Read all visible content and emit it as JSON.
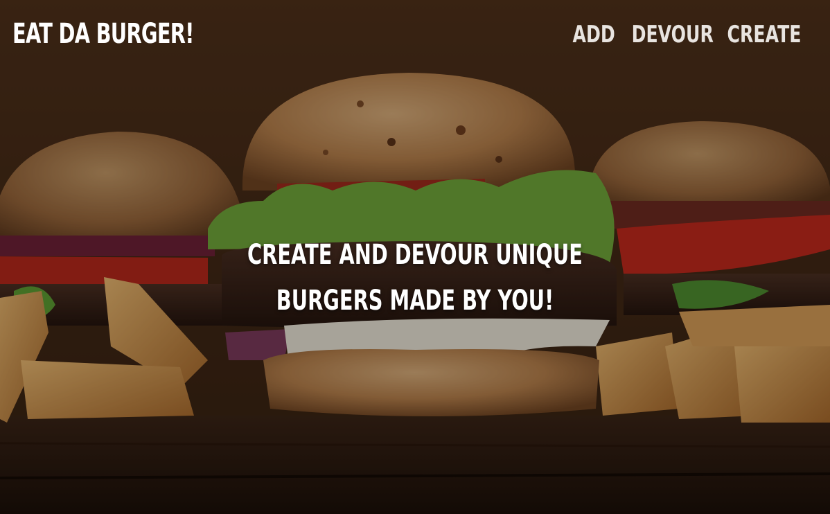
{
  "app": {
    "brand": "EAT DA BURGER!"
  },
  "nav": {
    "items": [
      {
        "label": "ADD"
      },
      {
        "label": "DEVOUR"
      },
      {
        "label": "CREATE"
      }
    ]
  },
  "hero": {
    "headline_line1": "CREATE AND DEVOUR UNIQUE",
    "headline_line2": "BURGERS MADE BY YOU!",
    "background_image": "burgers-and-fries-photo"
  },
  "colors": {
    "brand_text": "#ffffff",
    "nav_text": "#e8e4e0",
    "headline_text": "#ffffff",
    "wood_dark": "#1c0f07"
  }
}
